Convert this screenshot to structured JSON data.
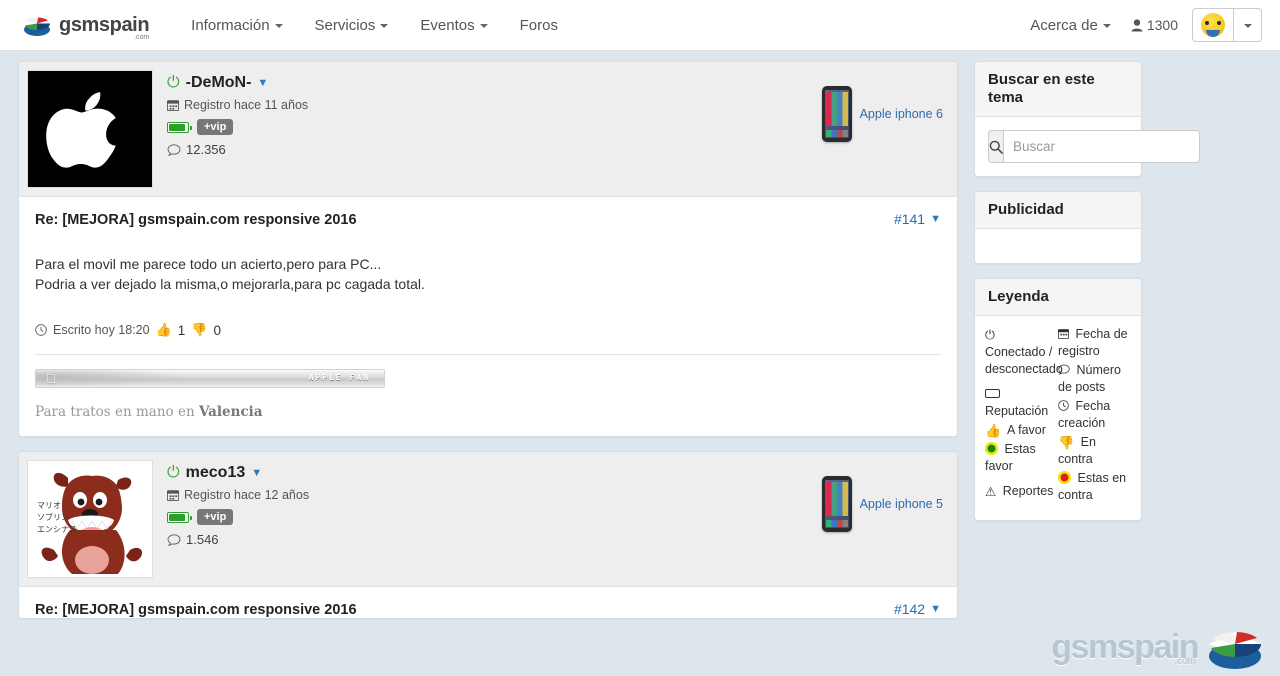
{
  "navbar": {
    "brand": "gsmspain",
    "brand_suffix": ".com",
    "links": [
      {
        "label": "Información",
        "has_caret": true,
        "icon": "chevron-down-icon"
      },
      {
        "label": "Servicios",
        "has_caret": true,
        "icon": "chevron-down-icon"
      },
      {
        "label": "Eventos",
        "has_caret": true,
        "icon": "chevron-down-icon"
      },
      {
        "label": "Foros",
        "has_caret": false,
        "icon": ""
      }
    ],
    "about_label": "Acerca de",
    "user_icon": "user-icon",
    "user_count": "1300",
    "avatar_icon": "smiley-avatar-icon",
    "avatar_caret_icon": "chevron-down-icon"
  },
  "posts": [
    {
      "avatar_icon": "apple-logo-avatar",
      "avatar_alt": "Apple logo",
      "status_icon": "power-icon",
      "username": "-DeMoN-",
      "username_caret_icon": "chevron-down-icon",
      "calendar_icon": "calendar-icon",
      "registered": "Registro hace 11 años",
      "battery_icon": "battery-icon",
      "vip_badge": "+vip",
      "posts_icon": "comment-icon",
      "posts_count": "12.356",
      "device_icon": "iphone-icon",
      "device_name": "Apple iphone 6",
      "title": "Re: [MEJORA] gsmspain.com responsive 2016",
      "number": "#141",
      "number_caret_icon": "chevron-down-icon",
      "text_lines": [
        "Para el movil me parece todo un acierto,pero para PC...",
        "Podria a ver dejado la misma,o mejorarla,para pc cagada total."
      ],
      "clock_icon": "clock-icon",
      "written": "Escrito hoy 18:20",
      "thumbup_icon": "thumbs-up-icon",
      "likes": "1",
      "thumbdown_icon": "thumbs-down-icon",
      "dislikes": "0",
      "signature_banner_label": "APPLE FAN",
      "signature_banner_icon": "apple-logo-icon",
      "signature_text_prefix": "Para tratos en mano en ",
      "signature_text_bold": "Valencia"
    },
    {
      "avatar_icon": "tasmanian-devil-avatar",
      "avatar_alt": "Tasmanian Devil",
      "avatar_jp_lines": [
        "マリオ",
        "ソブリン",
        "エンシナス"
      ],
      "status_icon": "power-icon",
      "username": "meco13",
      "username_caret_icon": "chevron-down-icon",
      "calendar_icon": "calendar-icon",
      "registered": "Registro hace 12 años",
      "battery_icon": "battery-icon",
      "vip_badge": "+vip",
      "posts_icon": "comment-icon",
      "posts_count": "1.546",
      "device_icon": "iphone-icon",
      "device_name": "Apple iphone 5",
      "title": "Re: [MEJORA] gsmspain.com responsive 2016",
      "number": "#142",
      "number_caret_icon": "chevron-down-icon"
    }
  ],
  "sidebar": {
    "search_panel": {
      "title": "Buscar en este tema",
      "search_icon": "search-icon",
      "input_value": "",
      "placeholder": "Buscar"
    },
    "ads_panel": {
      "title": "Publicidad"
    },
    "legend_panel": {
      "title": "Leyenda",
      "left": [
        {
          "icon": "power-icon",
          "label": "Conectado / desconectado"
        },
        {
          "icon": "reputation-icon",
          "label": "Reputación"
        },
        {
          "icon": "thumbs-up-icon",
          "label": "A favor"
        },
        {
          "icon": "green-dot-icon",
          "label": "Estas favor"
        },
        {
          "icon": "warning-icon",
          "label": "Reportes"
        }
      ],
      "right": [
        {
          "icon": "calendar-icon",
          "label": "Fecha de registro"
        },
        {
          "icon": "comment-icon",
          "label": "Número de posts"
        },
        {
          "icon": "clock-icon",
          "label": "Fecha creación"
        },
        {
          "icon": "thumbs-down-icon",
          "label": "En contra"
        },
        {
          "icon": "red-dot-icon",
          "label": "Estas en contra"
        }
      ]
    }
  },
  "watermark": {
    "text": "gsmspain",
    "suffix": ".com",
    "logo_icon": "gsmspain-pie-logo"
  },
  "colors": {
    "page_bg": "#dde6ec",
    "link": "#2b6cb0",
    "online_green": "#3aa63a",
    "vip_grey": "#777777",
    "thumb_up": "#3a9a3a",
    "thumb_down": "#d23b2e"
  }
}
